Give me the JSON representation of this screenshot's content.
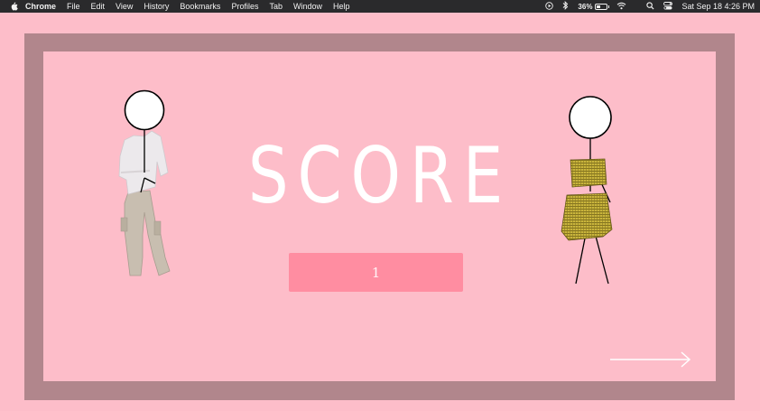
{
  "menubar": {
    "app_name": "Chrome",
    "menus": [
      "File",
      "Edit",
      "View",
      "History",
      "Bookmarks",
      "Profiles",
      "Tab",
      "Window",
      "Help"
    ],
    "battery_percent": "36%",
    "battery_level": 0.36,
    "clock": "Sat Sep 18  4:26 PM",
    "icons": [
      "apple-icon",
      "play-circle-icon",
      "bluetooth-icon",
      "battery-icon",
      "wifi-icon",
      "search-icon",
      "control-center-icon"
    ]
  },
  "game": {
    "title": "SCORE",
    "score": "1",
    "next_icon": "right-arrow-icon",
    "colors": {
      "background": "#fdbdc9",
      "frame": "#b1868c",
      "score_box": "#ff8da1",
      "title_text": "#ffffff"
    },
    "characters": [
      {
        "name": "left-character",
        "outfit": "white top with beige cargo pants"
      },
      {
        "name": "right-character",
        "outfit": "yellow plaid top and skirt"
      }
    ]
  }
}
